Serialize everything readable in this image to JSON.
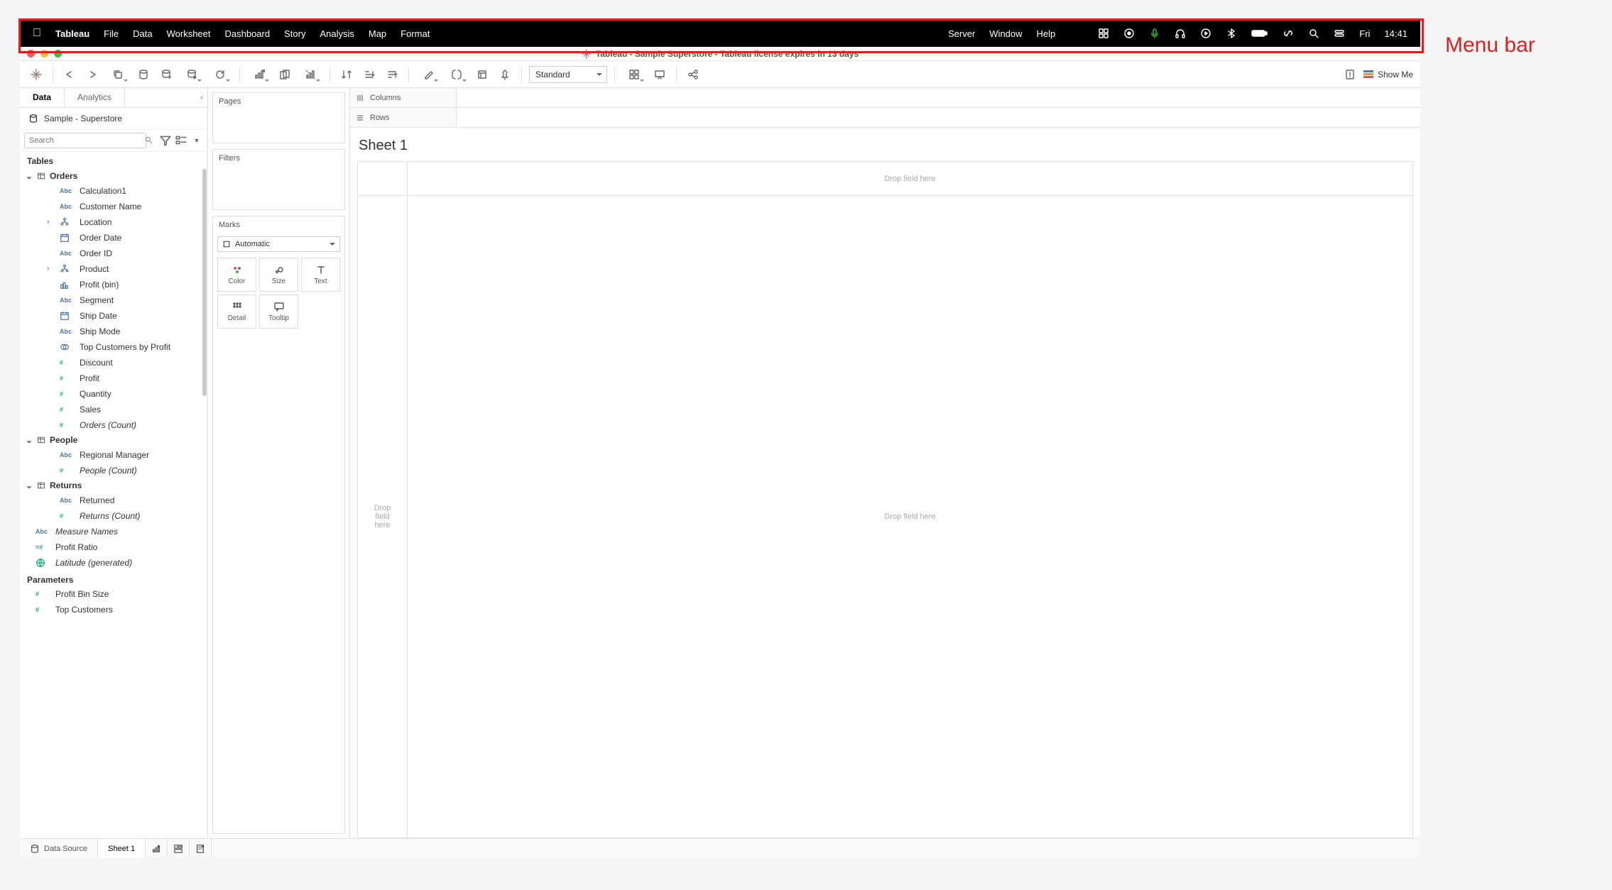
{
  "annotation": {
    "label": "Menu bar"
  },
  "menubar": {
    "app": "Tableau",
    "items": [
      "File",
      "Data",
      "Worksheet",
      "Dashboard",
      "Story",
      "Analysis",
      "Map",
      "Format"
    ],
    "right_items": [
      "Server",
      "Window",
      "Help"
    ],
    "clock_day": "Fri",
    "clock_time": "14:41"
  },
  "window": {
    "title": "Tableau - Sample Superstore - Tableau license expires in 13 days"
  },
  "toolbar": {
    "fit_mode": "Standard",
    "showme": "Show Me"
  },
  "left": {
    "tab_data": "Data",
    "tab_analytics": "Analytics",
    "datasource": "Sample - Superstore",
    "search_placeholder": "Search",
    "tables_hdr": "Tables",
    "parameters_hdr": "Parameters",
    "tables": [
      {
        "name": "Orders",
        "fields": [
          {
            "t": "abc_calc",
            "n": "Calculation1"
          },
          {
            "t": "abc",
            "n": "Customer Name"
          },
          {
            "t": "hier",
            "n": "Location",
            "exp": true
          },
          {
            "t": "date",
            "n": "Order Date"
          },
          {
            "t": "abc",
            "n": "Order ID"
          },
          {
            "t": "hier",
            "n": "Product",
            "exp": true
          },
          {
            "t": "bin",
            "n": "Profit (bin)"
          },
          {
            "t": "abc",
            "n": "Segment"
          },
          {
            "t": "date",
            "n": "Ship Date"
          },
          {
            "t": "abc",
            "n": "Ship Mode"
          },
          {
            "t": "set",
            "n": "Top Customers by Profit"
          },
          {
            "t": "num",
            "n": "Discount",
            "m": true
          },
          {
            "t": "num",
            "n": "Profit",
            "m": true
          },
          {
            "t": "num",
            "n": "Quantity",
            "m": true
          },
          {
            "t": "num",
            "n": "Sales",
            "m": true
          },
          {
            "t": "num",
            "n": "Orders (Count)",
            "m": true,
            "i": true
          }
        ]
      },
      {
        "name": "People",
        "fields": [
          {
            "t": "abc",
            "n": "Regional Manager"
          },
          {
            "t": "num",
            "n": "People (Count)",
            "m": true,
            "i": true
          }
        ]
      },
      {
        "name": "Returns",
        "fields": [
          {
            "t": "abc",
            "n": "Returned"
          },
          {
            "t": "num",
            "n": "Returns (Count)",
            "m": true,
            "i": true
          }
        ]
      }
    ],
    "loose_fields": [
      {
        "t": "abc",
        "n": "Measure Names",
        "i": true
      },
      {
        "t": "calc",
        "n": "Profit Ratio",
        "m": true
      },
      {
        "t": "geo",
        "n": "Latitude (generated)",
        "i": true,
        "m": true
      }
    ],
    "parameters": [
      {
        "t": "num",
        "n": "Profit Bin Size",
        "m": true
      },
      {
        "t": "num",
        "n": "Top Customers",
        "m": true
      }
    ]
  },
  "shelves": {
    "pages": "Pages",
    "filters": "Filters",
    "marks": "Marks",
    "marks_type": "Automatic",
    "mark_buttons": [
      "Color",
      "Size",
      "Text",
      "Detail",
      "Tooltip"
    ],
    "columns": "Columns",
    "rows": "Rows"
  },
  "sheet": {
    "title": "Sheet 1",
    "drop_top": "Drop field here",
    "drop_left": "Drop\nfield\nhere",
    "drop_main": "Drop field here"
  },
  "bottom": {
    "datasource": "Data Source",
    "sheet": "Sheet 1"
  }
}
